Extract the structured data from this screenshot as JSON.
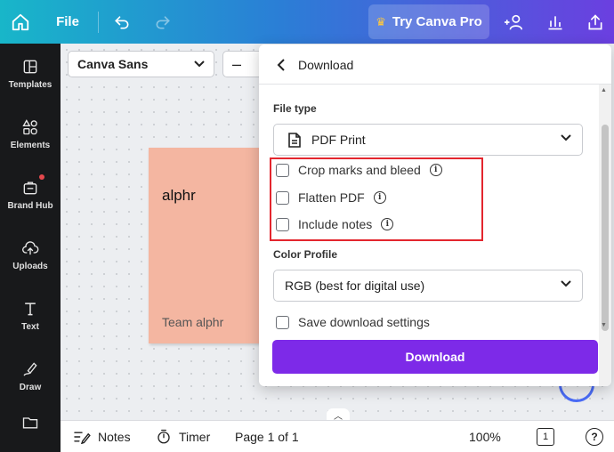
{
  "topbar": {
    "file_label": "File",
    "pro_label": "Try Canva Pro"
  },
  "sidebar": {
    "items": [
      {
        "label": "Templates",
        "icon": "templates-icon"
      },
      {
        "label": "Elements",
        "icon": "elements-icon"
      },
      {
        "label": "Brand Hub",
        "icon": "brand-hub-icon"
      },
      {
        "label": "Uploads",
        "icon": "uploads-icon"
      },
      {
        "label": "Text",
        "icon": "text-icon"
      },
      {
        "label": "Draw",
        "icon": "draw-icon"
      },
      {
        "label": "",
        "icon": "folder-icon"
      }
    ]
  },
  "toolbar": {
    "font_name": "Canva Sans",
    "size_minus": "–"
  },
  "canvas": {
    "card_title": "alphr",
    "card_subtitle": "Team alphr"
  },
  "download_panel": {
    "title": "Download",
    "file_type_label": "File type",
    "file_type_value": "PDF Print",
    "options": [
      {
        "label": "Crop marks and bleed",
        "checked": false
      },
      {
        "label": "Flatten PDF",
        "checked": false
      },
      {
        "label": "Include notes",
        "checked": false
      }
    ],
    "color_profile_label": "Color Profile",
    "color_profile_value": "RGB (best for digital use)",
    "save_settings_label": "Save download settings",
    "download_button": "Download",
    "accent_color": "#7d2ae8",
    "highlight_color": "#e3262e"
  },
  "bottombar": {
    "notes_label": "Notes",
    "timer_label": "Timer",
    "page_indicator": "Page 1 of 1",
    "zoom": "100%",
    "pages_count": "1",
    "help_label": "?"
  }
}
